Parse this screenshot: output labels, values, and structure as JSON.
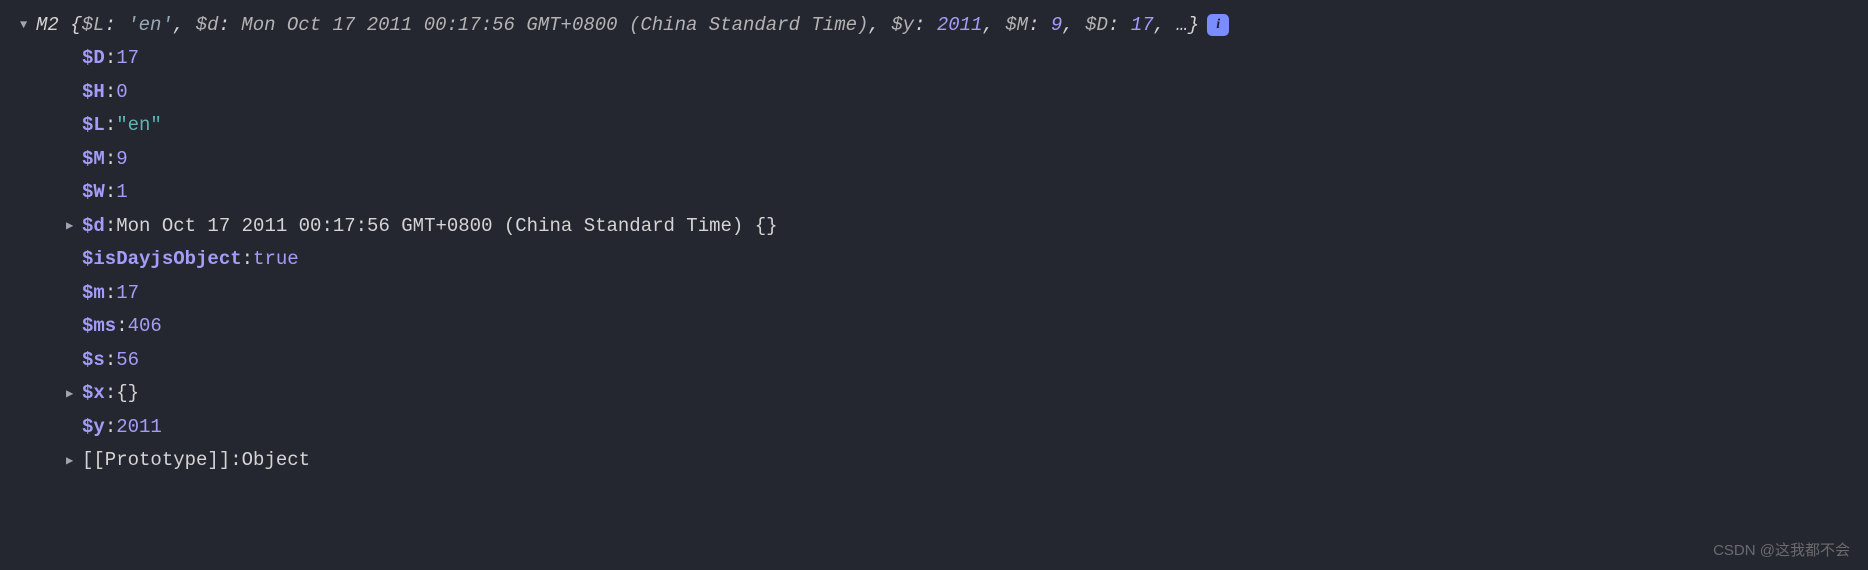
{
  "header": {
    "className": "M2",
    "preview": {
      "L_key": "$L",
      "L_val": "'en'",
      "d_key": "$d",
      "d_val": "Mon Oct 17 2011 00:17:56 GMT+0800 (China Standard Time)",
      "y_key": "$y",
      "y_val": "2011",
      "M_key": "$M",
      "M_val": "9",
      "D_key": "$D",
      "D_val": "17",
      "ellipsis": "…"
    },
    "infoLabel": "i"
  },
  "props": {
    "D_key": "$D",
    "D_val": "17",
    "H_key": "$H",
    "H_val": "0",
    "L_key": "$L",
    "L_val": "\"en\"",
    "M_key": "$M",
    "M_val": "9",
    "W_key": "$W",
    "W_val": "1",
    "d_key": "$d",
    "d_val": "Mon Oct 17 2011 00:17:56 GMT+0800 (China Standard Time)",
    "d_brace": "{}",
    "isDayjs_key": "$isDayjsObject",
    "isDayjs_val": "true",
    "m_key": "$m",
    "m_val": "17",
    "ms_key": "$ms",
    "ms_val": "406",
    "s_key": "$s",
    "s_val": "56",
    "x_key": "$x",
    "x_val": "{}",
    "y_key": "$y",
    "y_val": "2011",
    "proto_key": "[[Prototype]]",
    "proto_val": "Object"
  },
  "watermark": "CSDN @这我都不会"
}
